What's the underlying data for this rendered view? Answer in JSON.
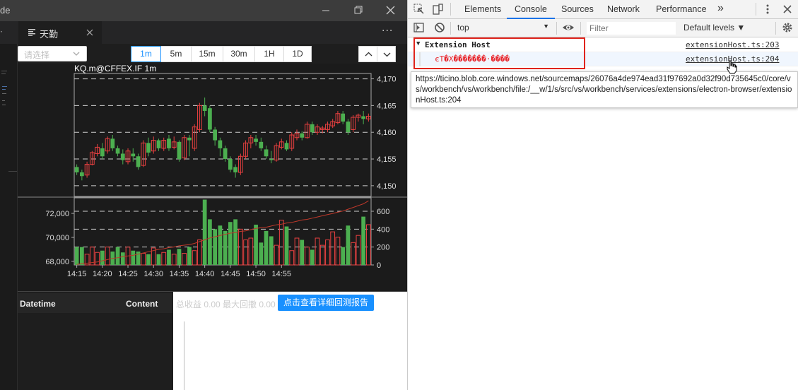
{
  "window": {
    "title_fragment": "de",
    "tab_label": "天勤",
    "more_label": "···"
  },
  "chart_toolbar": {
    "select_placeholder": "请选择",
    "periods": [
      {
        "label": "1m",
        "active": true
      },
      {
        "label": "5m",
        "active": false
      },
      {
        "label": "15m",
        "active": false
      },
      {
        "label": "30m",
        "active": false
      },
      {
        "label": "1H",
        "active": false
      },
      {
        "label": "1D",
        "active": false
      }
    ]
  },
  "chart_data": {
    "type": "candlestick",
    "title": "KQ.m@CFFEX.IF 1m",
    "x_ticks": [
      "14:15",
      "14:20",
      "14:25",
      "14:30",
      "14:35",
      "14:40",
      "14:45",
      "14:50",
      "14:55"
    ],
    "price_axis": {
      "ticks": [
        4150,
        4155,
        4160,
        4165,
        4170
      ],
      "ylim": [
        4148,
        4171
      ]
    },
    "volume_axis": {
      "ticks": [
        0,
        200,
        400,
        600
      ],
      "ylim": [
        0,
        750
      ]
    },
    "open_interest_axis": {
      "ticks": [
        68000,
        70000,
        72000
      ],
      "ylim": [
        67700,
        73300
      ]
    },
    "grid": true,
    "colors": {
      "up": "#e84040",
      "down": "#4caf50",
      "oi_line": "#c0392b",
      "grid": "#cccccc",
      "background": "#1b1b1b"
    },
    "candles": [
      [
        4153.5,
        4152.5,
        4154.0,
        4152.0
      ],
      [
        4152.5,
        4151.8,
        4153.0,
        4151.0
      ],
      [
        4152.0,
        4154.0,
        4154.5,
        4151.5
      ],
      [
        4154.0,
        4156.2,
        4156.5,
        4153.8
      ],
      [
        4156.0,
        4157.2,
        4157.8,
        4155.5
      ],
      [
        4157.0,
        4155.5,
        4158.0,
        4155.0
      ],
      [
        4156.5,
        4158.8,
        4159.2,
        4156.0
      ],
      [
        4158.8,
        4157.0,
        4159.5,
        4156.5
      ],
      [
        4157.0,
        4156.0,
        4157.5,
        4155.5
      ],
      [
        4156.0,
        4154.8,
        4156.8,
        4154.0
      ],
      [
        4154.5,
        4156.5,
        4157.0,
        4154.0
      ],
      [
        4156.0,
        4155.5,
        4157.0,
        4154.5
      ],
      [
        4155.5,
        4153.5,
        4156.0,
        4153.0
      ],
      [
        4153.8,
        4158.0,
        4158.5,
        4153.5
      ],
      [
        4158.0,
        4156.2,
        4159.0,
        4155.5
      ],
      [
        4156.5,
        4158.5,
        4159.2,
        4156.0
      ],
      [
        4158.5,
        4157.0,
        4158.8,
        4156.5
      ],
      [
        4157.0,
        4158.5,
        4159.0,
        4156.5
      ],
      [
        4158.8,
        4157.0,
        4159.5,
        4156.5
      ],
      [
        4157.2,
        4158.2,
        4159.2,
        4156.8
      ],
      [
        4158.2,
        4155.0,
        4158.5,
        4154.5
      ],
      [
        4155.2,
        4159.0,
        4159.5,
        4154.8
      ],
      [
        4159.0,
        4158.5,
        4159.5,
        4155.5
      ],
      [
        4157.0,
        4161.0,
        4161.5,
        4156.5
      ],
      [
        4160.5,
        4165.0,
        4165.5,
        4160.0
      ],
      [
        4165.0,
        4164.0,
        4166.5,
        4163.0
      ],
      [
        4164.5,
        4160.5,
        4165.0,
        4160.0
      ],
      [
        4160.5,
        4158.5,
        4161.0,
        4157.5
      ],
      [
        4158.5,
        4157.0,
        4159.0,
        4155.5
      ],
      [
        4157.0,
        4155.0,
        4157.5,
        4154.5
      ],
      [
        4155.0,
        4153.0,
        4155.5,
        4152.5
      ],
      [
        4153.5,
        4152.5,
        4154.0,
        4151.5
      ],
      [
        4152.5,
        4155.5,
        4156.0,
        4152.0
      ],
      [
        4155.5,
        4158.0,
        4158.5,
        4155.0
      ],
      [
        4158.0,
        4159.0,
        4159.5,
        4157.0
      ],
      [
        4158.8,
        4158.2,
        4159.5,
        4157.5
      ],
      [
        4158.2,
        4157.0,
        4159.0,
        4156.5
      ],
      [
        4156.8,
        4155.5,
        4157.5,
        4155.0
      ],
      [
        4155.0,
        4154.8,
        4156.5,
        4154.2
      ],
      [
        4154.8,
        4157.5,
        4158.0,
        4154.5
      ],
      [
        4157.2,
        4158.2,
        4158.8,
        4156.8
      ],
      [
        4158.0,
        4156.8,
        4158.5,
        4156.5
      ],
      [
        4157.0,
        4159.5,
        4160.0,
        4156.5
      ],
      [
        4159.0,
        4159.8,
        4160.5,
        4158.5
      ],
      [
        4159.8,
        4159.0,
        4160.2,
        4158.5
      ],
      [
        4159.0,
        4161.5,
        4162.0,
        4158.8
      ],
      [
        4161.5,
        4160.0,
        4162.0,
        4159.5
      ],
      [
        4160.0,
        4161.0,
        4161.5,
        4159.5
      ],
      [
        4160.5,
        4160.8,
        4161.2,
        4159.8
      ],
      [
        4160.5,
        4161.5,
        4162.0,
        4160.0
      ],
      [
        4161.2,
        4162.0,
        4162.5,
        4160.8
      ],
      [
        4161.8,
        4163.5,
        4164.0,
        4161.5
      ],
      [
        4163.5,
        4162.0,
        4164.0,
        4161.5
      ],
      [
        4162.0,
        4160.0,
        4162.5,
        4159.5
      ],
      [
        4160.5,
        4162.8,
        4163.2,
        4160.0
      ],
      [
        4162.8,
        4163.2,
        4163.5,
        4162.0
      ],
      [
        4163.0,
        4162.5,
        4164.0,
        4161.5
      ],
      [
        4162.5,
        4163.0,
        4163.5,
        4162.0
      ]
    ],
    "volumes": [
      200,
      200,
      120,
      200,
      140,
      160,
      200,
      150,
      200,
      140,
      200,
      160,
      150,
      130,
      120,
      190,
      120,
      140,
      170,
      120,
      180,
      130,
      200,
      160,
      280,
      730,
      510,
      400,
      440,
      380,
      480,
      510,
      400,
      280,
      300,
      450,
      250,
      380,
      320,
      220,
      500,
      430,
      160,
      300,
      280,
      200,
      170,
      300,
      220,
      280,
      370,
      310,
      200,
      440,
      250,
      330,
      540,
      450
    ],
    "open_interest": [
      67750,
      67800,
      67850,
      67900,
      67950,
      68050,
      68150,
      68250,
      68300,
      68400,
      68450,
      68500,
      68600,
      68700,
      68800,
      68900,
      69000,
      69050,
      69150,
      69200,
      69300,
      69350,
      69400,
      69500,
      69650,
      69800,
      69950,
      70050,
      70150,
      70250,
      70350,
      70400,
      70500,
      70550,
      70650,
      70750,
      70800,
      70850,
      70950,
      71050,
      71100,
      71200,
      71250,
      71350,
      71450,
      71500,
      71600,
      71700,
      71800,
      71900,
      72000,
      72100,
      72200,
      72350,
      72500,
      72650,
      72800,
      73050
    ]
  },
  "bottom": {
    "col_datetime": "Datetime",
    "col_content": "Content",
    "stats_text": "总收益 0.00 最大回撤 0.00",
    "report_button": "点击查看详细回测报告"
  },
  "devtools": {
    "tabs": [
      {
        "label": "Elements",
        "active": false
      },
      {
        "label": "Console",
        "active": true
      },
      {
        "label": "Sources",
        "active": false
      },
      {
        "label": "Network",
        "active": false
      },
      {
        "label": "Performance",
        "active": false
      }
    ],
    "more_tabs": "»",
    "context": "top",
    "filter_placeholder": "Filter",
    "levels": "Default levels ▼",
    "group_title": "Extension Host",
    "group_source": "extensionHost.ts:203",
    "message_text": "єТ�Х�������·����",
    "message_source": "extensionHost.ts:204",
    "tooltip": "https://ticino.blob.core.windows.net/sourcemaps/26076a4de974ead31f97692a0d32f90d735645c0/core/vs/workbench/vs/workbench/file:/__w/1/s/src/vs/workbench/services/extensions/electron-browser/extensionHost.ts:204",
    "highlight_color": "#e0241c",
    "accent_color": "#1a73e8"
  }
}
